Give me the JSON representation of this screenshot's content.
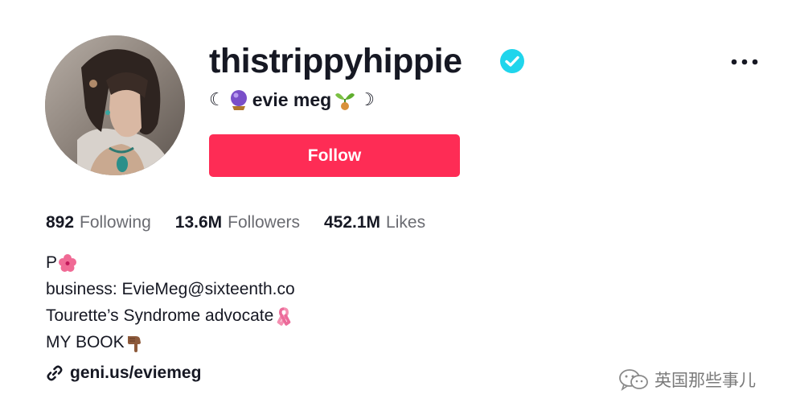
{
  "profile": {
    "username": "thistrippyhippie",
    "verified": true,
    "display_name": {
      "prefix": "☾",
      "name": "evie meg",
      "suffix": "☽",
      "leading_emoji": "crystal-ball-icon",
      "trailing_emoji": "seedling-icon"
    },
    "follow_label": "Follow"
  },
  "stats": [
    {
      "value": "892",
      "label": "Following"
    },
    {
      "value": "13.6M",
      "label": "Followers"
    },
    {
      "value": "452.1M",
      "label": "Likes"
    }
  ],
  "bio": {
    "line1": "P",
    "line2": "business: EvieMeg@sixteenth.co",
    "line3": "Tourette’s Syndrome advocate",
    "line4": "MY BOOK"
  },
  "link": {
    "text": "geni.us/eviemeg"
  },
  "watermark": {
    "text": "英国那些事儿"
  },
  "colors": {
    "follow_button": "#fe2c55",
    "verified_badge": "#20d5ec",
    "secondary_text": "#6a6b71",
    "primary_text": "#161823"
  }
}
